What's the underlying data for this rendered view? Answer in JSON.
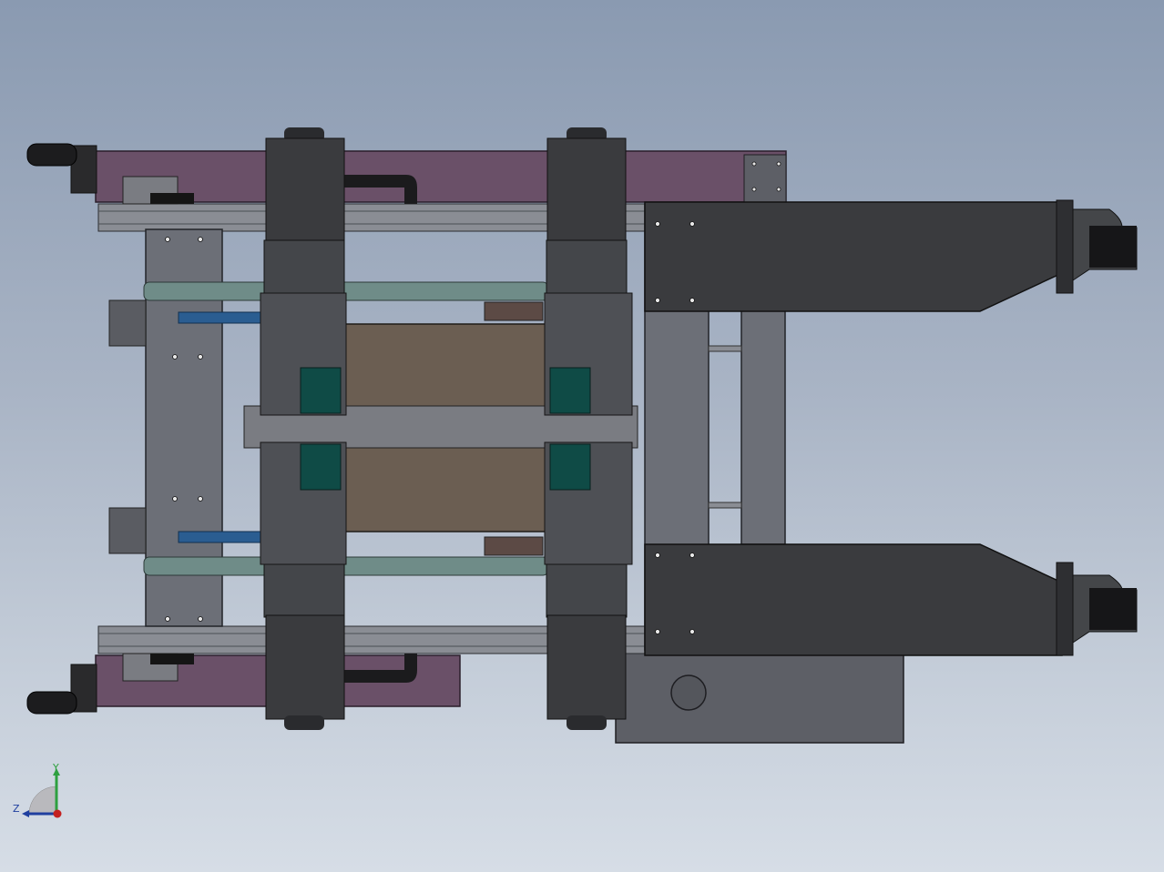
{
  "colors": {
    "frame_purple": "#6a5068",
    "frame_dark": "#3d3d42",
    "extrusion": "#8a8d94",
    "roller": "#3a3b3e",
    "shaft": "#6f8c88",
    "plate": "#6b5e52",
    "motor_teal": "#0f4b46",
    "cylinder_blue": "#2a5d91",
    "base_grey": "#5d5f66"
  },
  "triad": {
    "y_label": "Y",
    "z_label": "Z",
    "y_color": "#2ea040",
    "z_color": "#1f3f9f",
    "x_color": "#c42020"
  }
}
